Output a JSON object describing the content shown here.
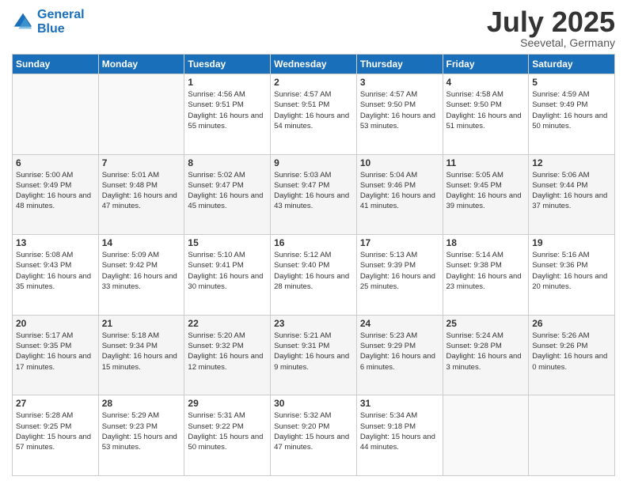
{
  "header": {
    "logo_line1": "General",
    "logo_line2": "Blue",
    "month": "July 2025",
    "location": "Seevetal, Germany"
  },
  "weekdays": [
    "Sunday",
    "Monday",
    "Tuesday",
    "Wednesday",
    "Thursday",
    "Friday",
    "Saturday"
  ],
  "weeks": [
    [
      {
        "day": "",
        "info": ""
      },
      {
        "day": "",
        "info": ""
      },
      {
        "day": "1",
        "info": "Sunrise: 4:56 AM\nSunset: 9:51 PM\nDaylight: 16 hours and 55 minutes."
      },
      {
        "day": "2",
        "info": "Sunrise: 4:57 AM\nSunset: 9:51 PM\nDaylight: 16 hours and 54 minutes."
      },
      {
        "day": "3",
        "info": "Sunrise: 4:57 AM\nSunset: 9:50 PM\nDaylight: 16 hours and 53 minutes."
      },
      {
        "day": "4",
        "info": "Sunrise: 4:58 AM\nSunset: 9:50 PM\nDaylight: 16 hours and 51 minutes."
      },
      {
        "day": "5",
        "info": "Sunrise: 4:59 AM\nSunset: 9:49 PM\nDaylight: 16 hours and 50 minutes."
      }
    ],
    [
      {
        "day": "6",
        "info": "Sunrise: 5:00 AM\nSunset: 9:49 PM\nDaylight: 16 hours and 48 minutes."
      },
      {
        "day": "7",
        "info": "Sunrise: 5:01 AM\nSunset: 9:48 PM\nDaylight: 16 hours and 47 minutes."
      },
      {
        "day": "8",
        "info": "Sunrise: 5:02 AM\nSunset: 9:47 PM\nDaylight: 16 hours and 45 minutes."
      },
      {
        "day": "9",
        "info": "Sunrise: 5:03 AM\nSunset: 9:47 PM\nDaylight: 16 hours and 43 minutes."
      },
      {
        "day": "10",
        "info": "Sunrise: 5:04 AM\nSunset: 9:46 PM\nDaylight: 16 hours and 41 minutes."
      },
      {
        "day": "11",
        "info": "Sunrise: 5:05 AM\nSunset: 9:45 PM\nDaylight: 16 hours and 39 minutes."
      },
      {
        "day": "12",
        "info": "Sunrise: 5:06 AM\nSunset: 9:44 PM\nDaylight: 16 hours and 37 minutes."
      }
    ],
    [
      {
        "day": "13",
        "info": "Sunrise: 5:08 AM\nSunset: 9:43 PM\nDaylight: 16 hours and 35 minutes."
      },
      {
        "day": "14",
        "info": "Sunrise: 5:09 AM\nSunset: 9:42 PM\nDaylight: 16 hours and 33 minutes."
      },
      {
        "day": "15",
        "info": "Sunrise: 5:10 AM\nSunset: 9:41 PM\nDaylight: 16 hours and 30 minutes."
      },
      {
        "day": "16",
        "info": "Sunrise: 5:12 AM\nSunset: 9:40 PM\nDaylight: 16 hours and 28 minutes."
      },
      {
        "day": "17",
        "info": "Sunrise: 5:13 AM\nSunset: 9:39 PM\nDaylight: 16 hours and 25 minutes."
      },
      {
        "day": "18",
        "info": "Sunrise: 5:14 AM\nSunset: 9:38 PM\nDaylight: 16 hours and 23 minutes."
      },
      {
        "day": "19",
        "info": "Sunrise: 5:16 AM\nSunset: 9:36 PM\nDaylight: 16 hours and 20 minutes."
      }
    ],
    [
      {
        "day": "20",
        "info": "Sunrise: 5:17 AM\nSunset: 9:35 PM\nDaylight: 16 hours and 17 minutes."
      },
      {
        "day": "21",
        "info": "Sunrise: 5:18 AM\nSunset: 9:34 PM\nDaylight: 16 hours and 15 minutes."
      },
      {
        "day": "22",
        "info": "Sunrise: 5:20 AM\nSunset: 9:32 PM\nDaylight: 16 hours and 12 minutes."
      },
      {
        "day": "23",
        "info": "Sunrise: 5:21 AM\nSunset: 9:31 PM\nDaylight: 16 hours and 9 minutes."
      },
      {
        "day": "24",
        "info": "Sunrise: 5:23 AM\nSunset: 9:29 PM\nDaylight: 16 hours and 6 minutes."
      },
      {
        "day": "25",
        "info": "Sunrise: 5:24 AM\nSunset: 9:28 PM\nDaylight: 16 hours and 3 minutes."
      },
      {
        "day": "26",
        "info": "Sunrise: 5:26 AM\nSunset: 9:26 PM\nDaylight: 16 hours and 0 minutes."
      }
    ],
    [
      {
        "day": "27",
        "info": "Sunrise: 5:28 AM\nSunset: 9:25 PM\nDaylight: 15 hours and 57 minutes."
      },
      {
        "day": "28",
        "info": "Sunrise: 5:29 AM\nSunset: 9:23 PM\nDaylight: 15 hours and 53 minutes."
      },
      {
        "day": "29",
        "info": "Sunrise: 5:31 AM\nSunset: 9:22 PM\nDaylight: 15 hours and 50 minutes."
      },
      {
        "day": "30",
        "info": "Sunrise: 5:32 AM\nSunset: 9:20 PM\nDaylight: 15 hours and 47 minutes."
      },
      {
        "day": "31",
        "info": "Sunrise: 5:34 AM\nSunset: 9:18 PM\nDaylight: 15 hours and 44 minutes."
      },
      {
        "day": "",
        "info": ""
      },
      {
        "day": "",
        "info": ""
      }
    ]
  ]
}
